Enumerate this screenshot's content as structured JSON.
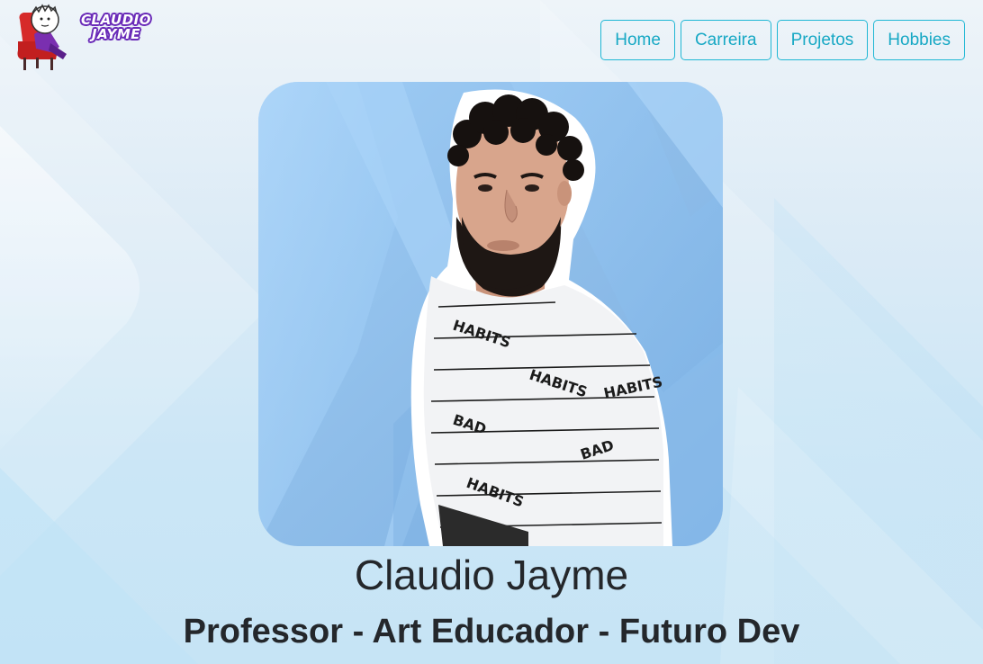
{
  "logo": {
    "line1": "CLAUDIO",
    "line2": "JAYME"
  },
  "nav": {
    "items": [
      {
        "label": "Home"
      },
      {
        "label": "Carreira"
      },
      {
        "label": "Projetos"
      },
      {
        "label": "Hobbies"
      }
    ]
  },
  "profile": {
    "shirt_text_1": "BAD",
    "shirt_text_2": "HABITS"
  },
  "hero": {
    "name": "Claudio Jayme",
    "subtitle": "Professor - Art Educador - Futuro Dev"
  },
  "colors": {
    "accent": "#1fb7d4",
    "text": "#24272b",
    "logo_outline": "#6a2bb8",
    "chair": "#d62a2a"
  }
}
